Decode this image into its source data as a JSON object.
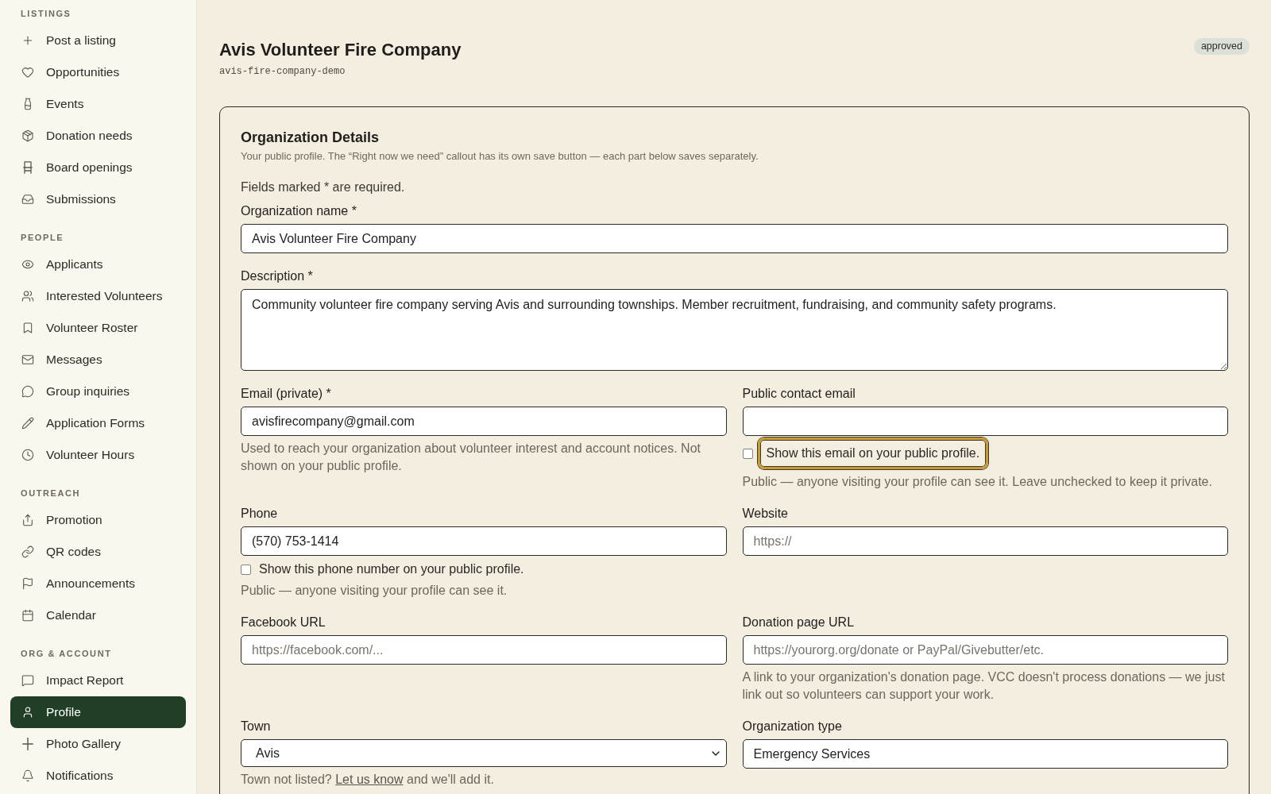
{
  "sidebar": {
    "sections": [
      {
        "heading": "LISTINGS",
        "items": [
          {
            "label": "Post a listing",
            "selected": false
          },
          {
            "label": "Opportunities",
            "selected": false
          },
          {
            "label": "Events",
            "selected": false
          },
          {
            "label": "Donation needs",
            "selected": false
          },
          {
            "label": "Board openings",
            "selected": false
          },
          {
            "label": "Submissions",
            "selected": false
          }
        ]
      },
      {
        "heading": "PEOPLE",
        "items": [
          {
            "label": "Applicants",
            "selected": false
          },
          {
            "label": "Interested Volunteers",
            "selected": false
          },
          {
            "label": "Volunteer Roster",
            "selected": false
          },
          {
            "label": "Messages",
            "selected": false
          },
          {
            "label": "Group inquiries",
            "selected": false
          },
          {
            "label": "Application Forms",
            "selected": false
          },
          {
            "label": "Volunteer Hours",
            "selected": false
          }
        ]
      },
      {
        "heading": "OUTREACH",
        "items": [
          {
            "label": "Promotion",
            "selected": false
          },
          {
            "label": "QR codes",
            "selected": false
          },
          {
            "label": "Announcements",
            "selected": false
          },
          {
            "label": "Calendar",
            "selected": false
          }
        ]
      },
      {
        "heading": "ORG & ACCOUNT",
        "items": [
          {
            "label": "Impact Report",
            "selected": false
          },
          {
            "label": "Profile",
            "selected": true
          },
          {
            "label": "Photo Gallery",
            "selected": false
          },
          {
            "label": "Notifications",
            "selected": false
          }
        ]
      }
    ]
  },
  "header": {
    "title": "Avis Volunteer Fire Company",
    "slug": "avis-fire-company-demo",
    "status": "approved"
  },
  "card": {
    "title": "Organization Details",
    "subtitle": "Your public profile. The “Right now we need” callout has its own save button — each part below saves separately.",
    "required_note": "Fields marked * are required.",
    "rows": [
      {
        "fields": [
          {
            "kind": "text",
            "label": "Organization name *",
            "value": "Avis Volunteer Fire Company"
          }
        ]
      },
      {
        "fields": [
          {
            "kind": "textarea",
            "label": "Description *",
            "value": "Community volunteer fire company serving Avis and surrounding townships. Member recruitment, fundraising, and community safety programs."
          }
        ]
      },
      {
        "fields": [
          {
            "kind": "text",
            "label": "Email (private) *",
            "value": "avisfirecompany@gmail.com",
            "help": "Used to reach your organization about volunteer interest and account notices. Not shown on your public profile."
          },
          {
            "kind": "text",
            "label": "Public contact email",
            "checkbox": {
              "label": "Show this email on your public profile.",
              "checked": false,
              "focused": true
            },
            "checkbox_help": "Public — anyone visiting your profile can see it. Leave unchecked to keep it private."
          }
        ]
      },
      {
        "fields": [
          {
            "kind": "text",
            "label": "Phone",
            "value": "(570) 753-1414",
            "checkbox": {
              "label": "Show this phone number on your public profile.",
              "checked": false,
              "focused": false
            },
            "checkbox_help": "Public — anyone visiting your profile can see it."
          },
          {
            "kind": "text",
            "label": "Website",
            "placeholder": "https://"
          }
        ]
      },
      {
        "fields": [
          {
            "kind": "text",
            "label": "Facebook URL",
            "placeholder": "https://facebook.com/..."
          },
          {
            "kind": "text",
            "label": "Donation page URL",
            "placeholder": "https://yourorg.org/donate or PayPal/Givebutter/etc.",
            "help": "A link to your organization's donation page. VCC doesn't process donations — we just link out so volunteers can support your work."
          }
        ]
      },
      {
        "fields": [
          {
            "kind": "select",
            "label": "Town",
            "value": "Avis",
            "help_link": {
              "before": "Town not listed?",
              "link": "Let us know",
              "after": "and we'll add it."
            }
          },
          {
            "kind": "text",
            "label": "Organization type",
            "value": "Emergency Services"
          }
        ]
      }
    ]
  }
}
